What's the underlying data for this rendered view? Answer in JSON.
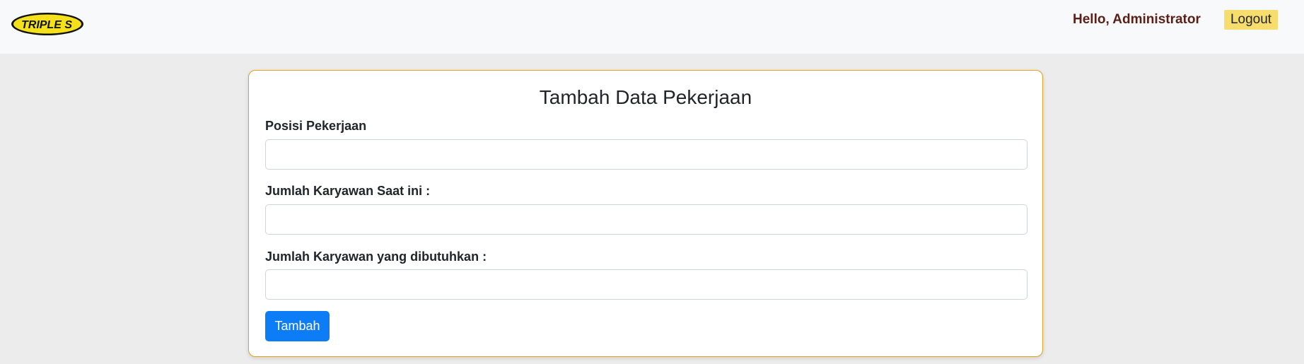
{
  "header": {
    "logo_text": "TRIPLE S",
    "greeting": "Hello, Administrator",
    "logout_label": "Logout"
  },
  "form": {
    "title": "Tambah Data Pekerjaan",
    "fields": [
      {
        "label": "Posisi Pekerjaan",
        "value": "",
        "placeholder": ""
      },
      {
        "label": "Jumlah Karyawan Saat ini :",
        "value": "",
        "placeholder": ""
      },
      {
        "label": "Jumlah Karyawan yang dibutuhkan :",
        "value": "",
        "placeholder": ""
      }
    ],
    "submit_label": "Tambah"
  },
  "colors": {
    "navbar_bg": "#f8f9fa",
    "page_bg": "#ececec",
    "card_border": "#e0a21f",
    "logout_bg": "#f7dd6e",
    "greeting_text": "#5a1f16",
    "submit_bg": "#0d7df7",
    "logo_yellow": "#f5e11a"
  }
}
